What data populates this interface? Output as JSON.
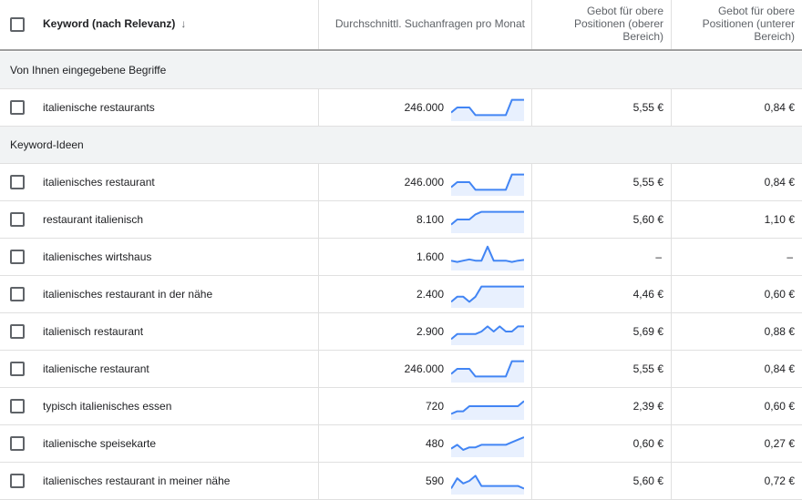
{
  "header": {
    "keyword": "Keyword (nach Relevanz)",
    "volume": "Durchschnittl. Suchanfragen pro Monat",
    "bid_top_low": "Gebot für obere Positionen (oberer Bereich)",
    "bid_top_high": "Gebot für obere Positionen (unterer Bereich)"
  },
  "colors": {
    "spark_line": "#4285f4",
    "spark_fill": "#e8f0fe",
    "group_bg": "#f1f3f4"
  },
  "groups": [
    {
      "label": "Von Ihnen eingegebene Begriffe",
      "rows": [
        {
          "keyword": "italienische restaurants",
          "volume": "246.000",
          "bid_high": "5,55 €",
          "bid_low": "0,84 €",
          "trend": [
            3,
            5,
            5,
            5,
            2,
            2,
            2,
            2,
            2,
            2,
            8,
            8,
            8
          ]
        }
      ]
    },
    {
      "label": "Keyword-Ideen",
      "rows": [
        {
          "keyword": "italienisches restaurant",
          "volume": "246.000",
          "bid_high": "5,55 €",
          "bid_low": "0,84 €",
          "trend": [
            3,
            5,
            5,
            5,
            2,
            2,
            2,
            2,
            2,
            2,
            8,
            8,
            8
          ]
        },
        {
          "keyword": "restaurant italienisch",
          "volume": "8.100",
          "bid_high": "5,60 €",
          "bid_low": "1,10 €",
          "trend": [
            3,
            5,
            5,
            5,
            7,
            8,
            8,
            8,
            8,
            8,
            8,
            8,
            8
          ]
        },
        {
          "keyword": "italienisches wirtshaus",
          "volume": "1.600",
          "bid_high": "–",
          "bid_low": "–",
          "trend": [
            3.5,
            3,
            3.5,
            4,
            3.5,
            3.5,
            9,
            3.5,
            3.5,
            3.5,
            3,
            3.5,
            3.8
          ]
        },
        {
          "keyword": "italienisches restaurant in der nähe",
          "volume": "2.400",
          "bid_high": "4,46 €",
          "bid_low": "0,60 €",
          "trend": [
            2,
            4,
            4,
            2,
            4,
            8,
            8,
            8,
            8,
            8,
            8,
            8,
            8
          ]
        },
        {
          "keyword": "italienisch restaurant",
          "volume": "2.900",
          "bid_high": "5,69 €",
          "bid_low": "0,88 €",
          "trend": [
            2,
            4,
            4,
            4,
            4,
            5,
            7,
            5,
            7,
            5,
            5,
            7,
            7
          ]
        },
        {
          "keyword": "italienische restaurant",
          "volume": "246.000",
          "bid_high": "5,55 €",
          "bid_low": "0,84 €",
          "trend": [
            3,
            5,
            5,
            5,
            2,
            2,
            2,
            2,
            2,
            2,
            8,
            8,
            8
          ]
        },
        {
          "keyword": "typisch italienisches essen",
          "volume": "720",
          "bid_high": "2,39 €",
          "bid_low": "0,60 €",
          "trend": [
            2,
            3,
            3,
            5,
            5,
            5,
            5,
            5,
            5,
            5,
            5,
            5,
            7
          ]
        },
        {
          "keyword": "italienische speisekarte",
          "volume": "480",
          "bid_high": "0,60 €",
          "bid_low": "0,27 €",
          "trend": [
            3,
            4.5,
            2.5,
            3.5,
            3.5,
            4.5,
            4.5,
            4.5,
            4.5,
            4.5,
            5.5,
            6.5,
            7.5
          ]
        },
        {
          "keyword": "italienisches restaurant in meiner nähe",
          "volume": "590",
          "bid_high": "5,60 €",
          "bid_low": "0,72 €",
          "trend": [
            2,
            6,
            4,
            5,
            7,
            3,
            3,
            3,
            3,
            3,
            3,
            3,
            2
          ]
        }
      ]
    }
  ]
}
